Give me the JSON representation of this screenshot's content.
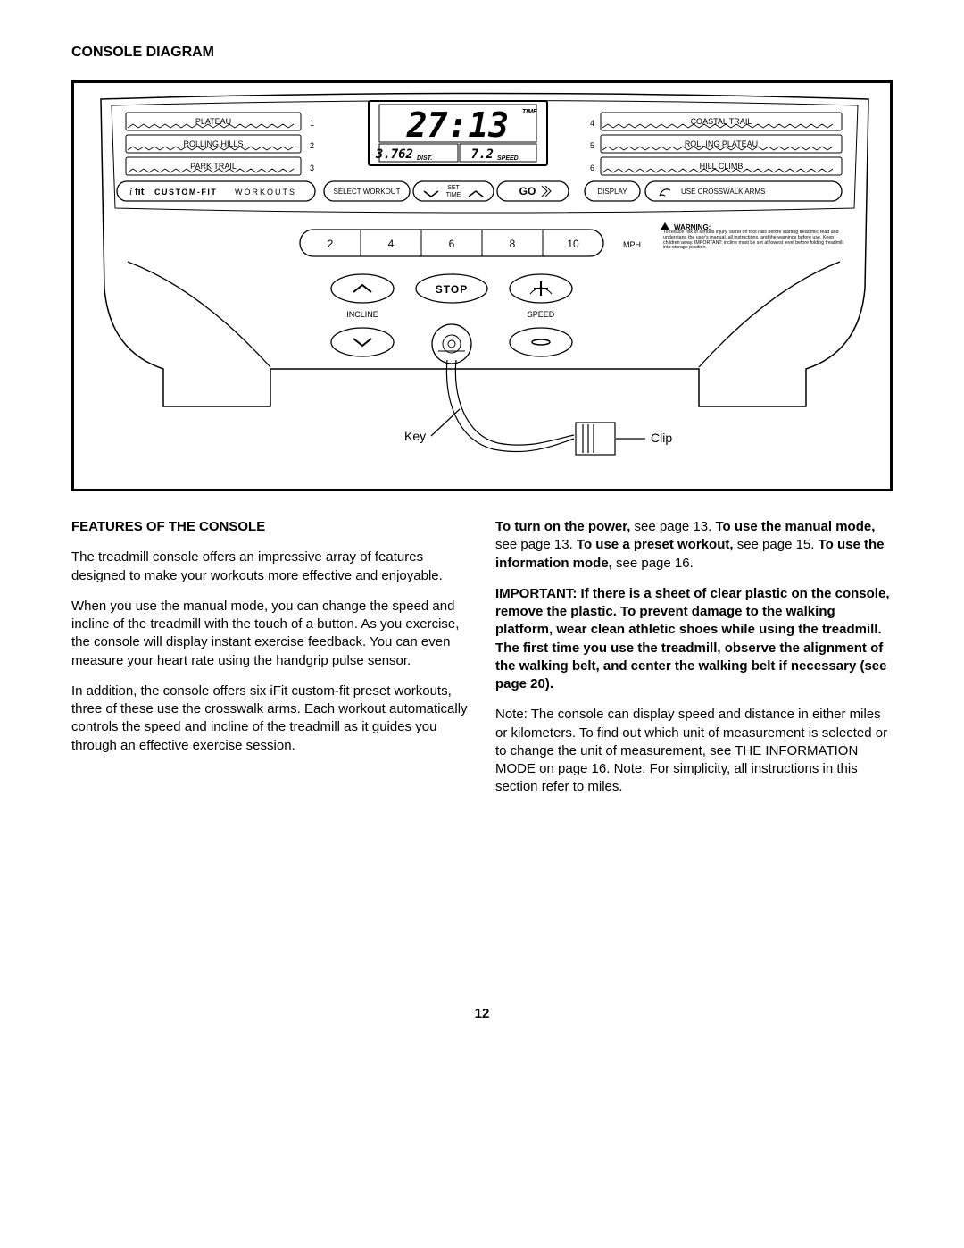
{
  "title": "CONSOLE DIAGRAM",
  "diagram": {
    "workouts_left": {
      "1": "PLATEAU",
      "2": "ROLLING HILLS",
      "3": "PARK TRAIL"
    },
    "workouts_right": {
      "4": "COASTAL TRAIL",
      "5": "ROLLING PLATEAU",
      "6": "HILL CLIMB"
    },
    "ifit_prefix": "i",
    "ifit_fit": "fit",
    "ifit_custom": "CUSTOM-FIT",
    "ifit_workouts": "WORKOUTS",
    "select_workout": "SELECT WORKOUT",
    "set_time_1": "SET",
    "set_time_2": "TIME",
    "go": "GO",
    "display_btn": "DISPLAY",
    "crosswalk": "USE CROSSWALK ARMS",
    "lcd": {
      "time_value": "27:13",
      "time_label": "TIME",
      "dist_value": "3.762",
      "dist_label": "DIST.",
      "speed_value": "7.2",
      "speed_label": "SPEED"
    },
    "speed_presets": [
      "2",
      "4",
      "6",
      "8",
      "10"
    ],
    "mph": "MPH",
    "warning_title": "WARNING:",
    "warning_text": "To reduce risk of serious injury, stand on foot rails before starting treadmill; read and understand the user's manual, all instructions, and the warnings before use. Keep children away. IMPORTANT: incline must be set at lowest level before folding treadmill into storage position.",
    "stop": "STOP",
    "incline": "INCLINE",
    "speed_label": "SPEED",
    "key": "Key",
    "clip": "Clip"
  },
  "features_heading": "FEATURES OF THE CONSOLE",
  "p1": "The treadmill console offers an impressive array of features designed to make your workouts more effective and enjoyable.",
  "p2": "When you use the manual mode, you can change the speed and incline of the treadmill with the touch of a button. As you exercise, the console will display instant exercise feedback. You can even measure your heart rate using the handgrip pulse sensor.",
  "p3": "In addition, the console offers six iFit custom-fit preset workouts, three of these use the crosswalk arms. Each workout automatically controls the speed and incline of the treadmill as it guides you through an effective exercise session.",
  "r1a": "To turn on the power, ",
  "r1b": "see page 13. ",
  "r1c": "To use the manual mode, ",
  "r1d": "see page 13. ",
  "r1e": "To use a preset workout, ",
  "r1f": "see page 15. ",
  "r1g": "To use the information mode, ",
  "r1h": "see page 16.",
  "r2": "IMPORTANT: If there is a sheet of clear plastic on the console, remove the plastic. To prevent damage to the walking platform, wear clean athletic shoes while using the treadmill. The first time you use the treadmill, observe the alignment of the walking belt, and center the walking belt if necessary (see page 20).",
  "r3": "Note: The console can display speed and distance in either miles or kilometers. To find out which unit of measurement is selected or to change the unit of measurement, see THE INFORMATION MODE on page 16. Note: For simplicity, all instructions in this section refer to miles.",
  "pagenum": "12"
}
